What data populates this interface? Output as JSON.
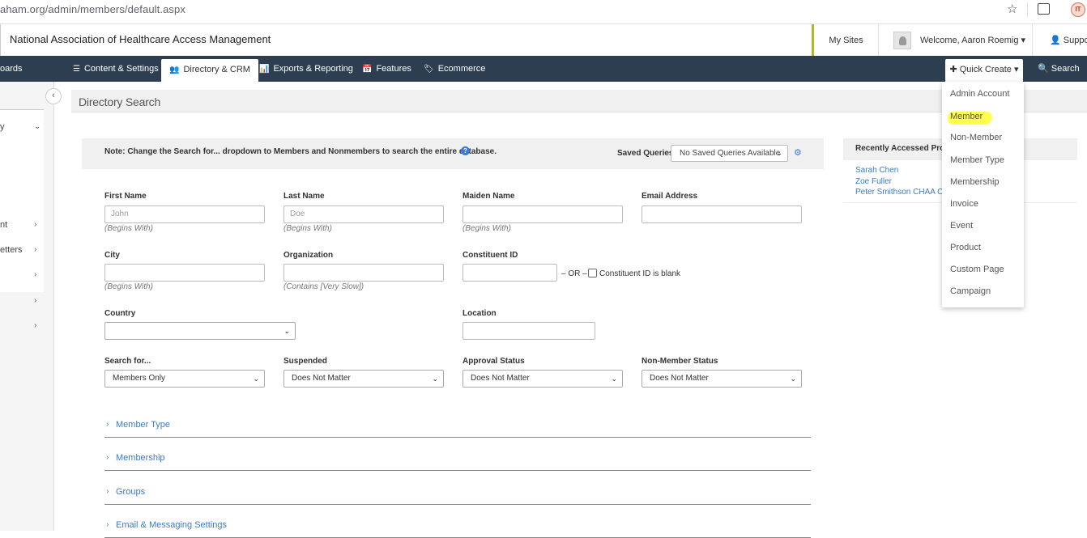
{
  "browser": {
    "url": "aham.org/admin/members/default.aspx",
    "avatar_initials": "IT"
  },
  "header": {
    "org_name": "National Association of Healthcare Access Management",
    "my_sites": "My Sites",
    "welcome": "Welcome, Aaron Roemig",
    "support": "Support"
  },
  "nav": {
    "dashboards": "oards",
    "content_settings": "Content & Settings",
    "directory_crm": "Directory & CRM",
    "exports_reporting": "Exports & Reporting",
    "features": "Features",
    "ecommerce": "Ecommerce",
    "quick_create": "Quick Create",
    "search": "Search"
  },
  "sidebar": {
    "items": [
      "y",
      "nt",
      "etters",
      "",
      "",
      ""
    ]
  },
  "page": {
    "title": "Directory Search"
  },
  "notebar": {
    "note": "Note: Change the Search for... dropdown to Members and Nonmembers to search the entire database.",
    "saved_queries_label": "Saved Queries:",
    "saved_queries_value": "No Saved Queries Available"
  },
  "form": {
    "first_name": {
      "label": "First Name",
      "placeholder": "John",
      "hint": "(Begins With)"
    },
    "last_name": {
      "label": "Last Name",
      "placeholder": "Doe",
      "hint": "(Begins With)"
    },
    "maiden_name": {
      "label": "Maiden Name",
      "hint": "(Begins With)"
    },
    "email": {
      "label": "Email Address"
    },
    "city": {
      "label": "City",
      "hint": "(Begins With)"
    },
    "organization": {
      "label": "Organization",
      "hint": "(Contains [Very Slow])"
    },
    "constituent_id": {
      "label": "Constituent ID",
      "or": "– OR –",
      "blank_label": "Constituent ID is blank"
    },
    "country": {
      "label": "Country",
      "value": ""
    },
    "location": {
      "label": "Location"
    },
    "search_for": {
      "label": "Search for...",
      "value": "Members Only"
    },
    "suspended": {
      "label": "Suspended",
      "value": "Does Not Matter"
    },
    "approval_status": {
      "label": "Approval Status",
      "value": "Does Not Matter"
    },
    "non_member_status": {
      "label": "Non-Member Status",
      "value": "Does Not Matter"
    }
  },
  "sections": [
    "Member Type",
    "Membership",
    "Groups",
    "Email & Messaging Settings"
  ],
  "recent": {
    "title": "Recently Accessed Profil",
    "links": [
      "Sarah Chen",
      "Zoe Fuller",
      "Peter Smithson CHAA CH"
    ]
  },
  "quick_create_menu": [
    "Admin Account",
    "Member",
    "Non-Member",
    "Member Type",
    "Membership",
    "Invoice",
    "Event",
    "Product",
    "Custom Page",
    "Campaign"
  ],
  "colors": {
    "navbar": "#2d3e50",
    "link": "#3a7bc8",
    "highlight": "#ffff3b",
    "accent": "#b5b52d"
  }
}
